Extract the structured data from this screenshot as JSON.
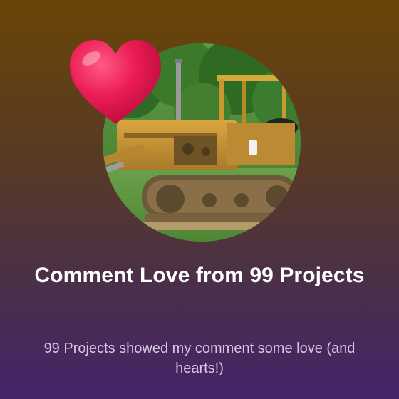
{
  "card": {
    "title": "Comment Love from 99 Projects",
    "subtitle": "99 Projects showed my comment some love (and hearts!)"
  },
  "icons": {
    "heart": "heart-icon"
  },
  "colors": {
    "background_top": "#6a4507",
    "background_bottom": "#44246a",
    "heart": "#e3124e",
    "title": "#ffffff",
    "subtitle": "#d7c7e2"
  }
}
